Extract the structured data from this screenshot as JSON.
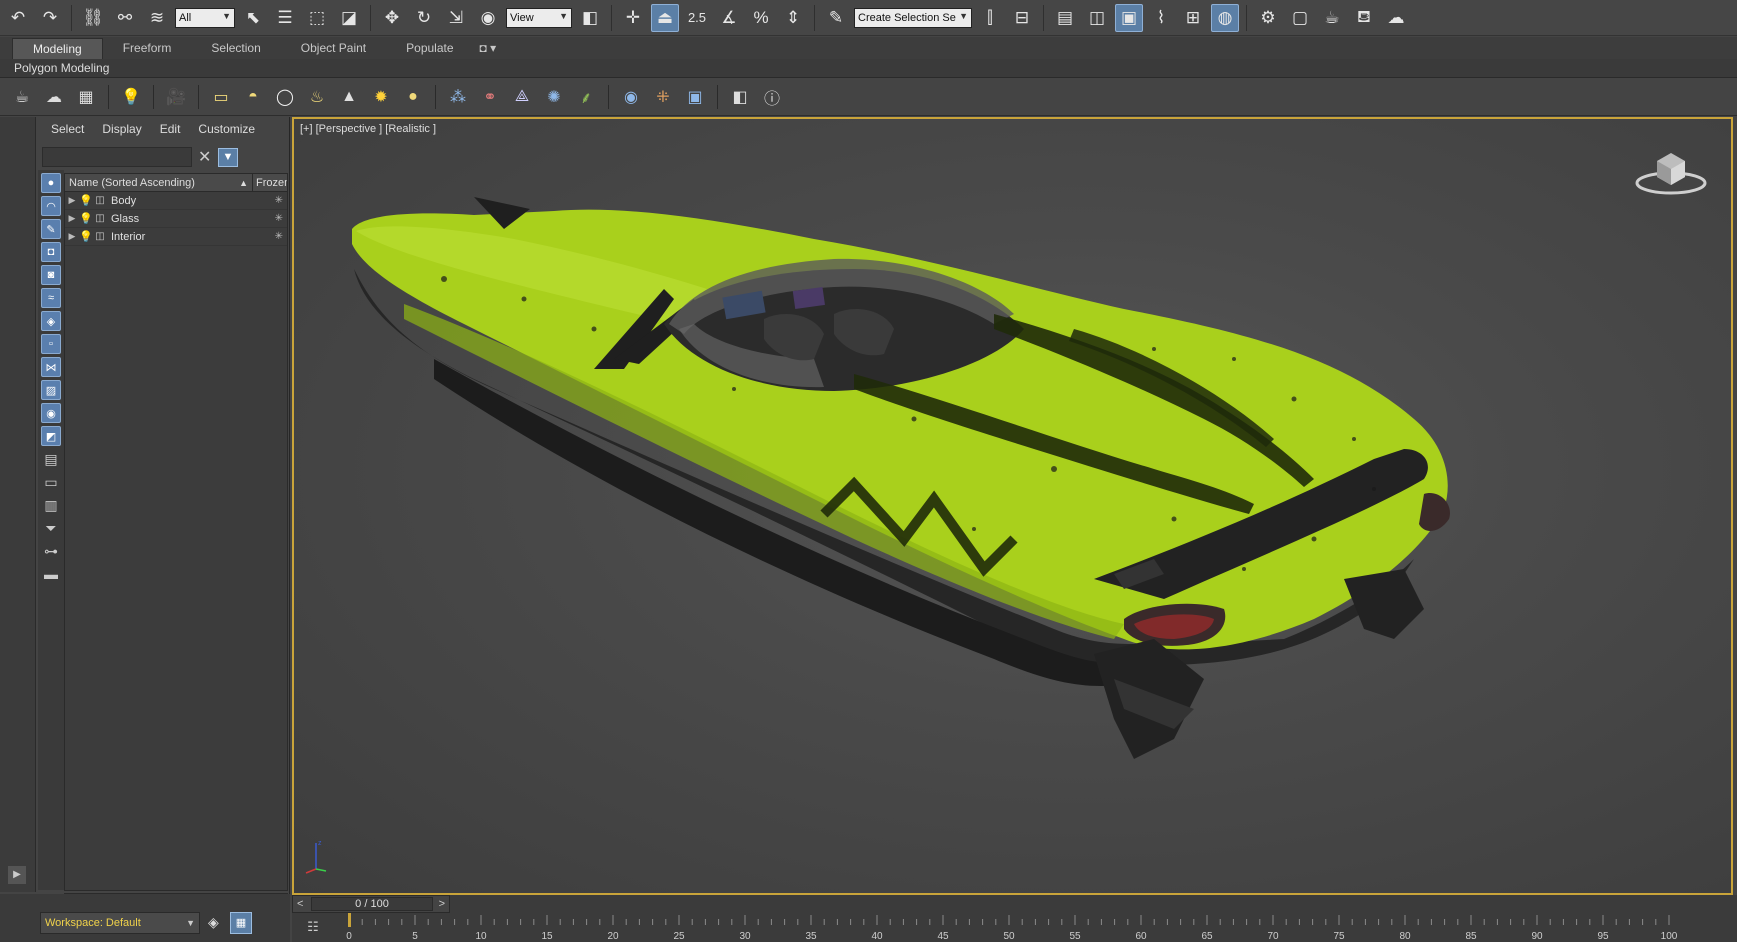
{
  "toolbar": {
    "selection_filter": "All",
    "coord_system": "View",
    "snap_angle_label": "2.5",
    "named_selection_placeholder": "Create Selection Se"
  },
  "ribbon": {
    "tabs": [
      "Modeling",
      "Freeform",
      "Selection",
      "Object Paint",
      "Populate"
    ],
    "active_tab": "Modeling",
    "subtitle": "Polygon Modeling"
  },
  "explorer": {
    "menu": [
      "Select",
      "Display",
      "Edit",
      "Customize"
    ],
    "col_name": "Name (Sorted Ascending)",
    "col_frozen": "Frozen",
    "rows": [
      {
        "name": "Body"
      },
      {
        "name": "Glass"
      },
      {
        "name": "Interior"
      }
    ]
  },
  "viewport": {
    "label": "[+] [Perspective ] [Realistic ]",
    "boat_color": "#a9d01c"
  },
  "status": {
    "workspace": "Workspace: Default"
  },
  "timeline": {
    "frame_text": "0 / 100",
    "ticks": [
      "0",
      "5",
      "10",
      "15",
      "20",
      "25",
      "30",
      "35",
      "40",
      "45",
      "50",
      "55",
      "60",
      "65",
      "70",
      "75",
      "80",
      "85",
      "90",
      "95",
      "100"
    ]
  },
  "colors": {
    "accent": "#5b7fa6",
    "viewport_border": "#c9a43a",
    "workspace_text": "#f0d24b"
  }
}
